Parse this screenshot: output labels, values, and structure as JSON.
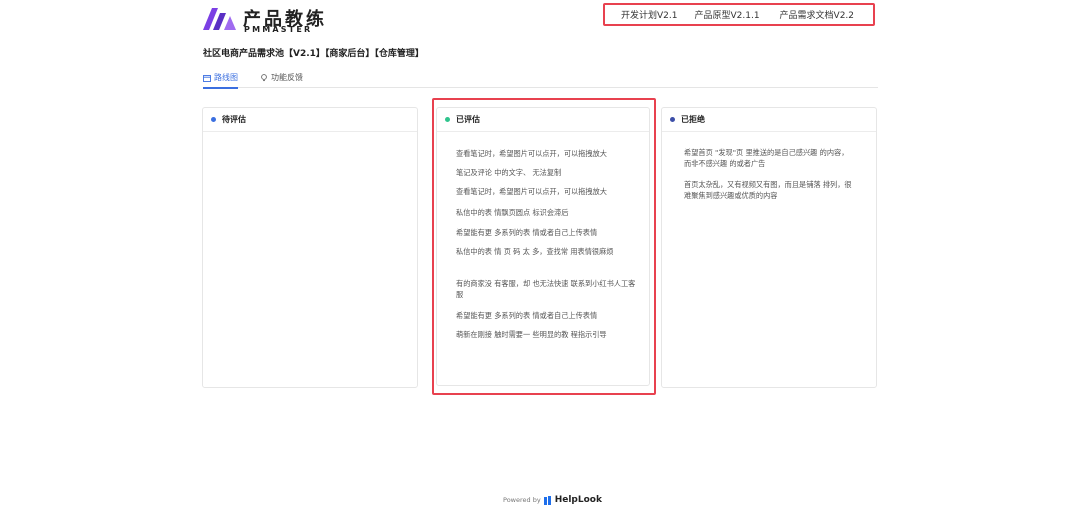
{
  "brand": {
    "name_cn": "产品教练",
    "name_en": "PMMASTER",
    "accent": "#7b3fe4"
  },
  "topnav": {
    "items": [
      "开发计划V2.1",
      "产品原型V2.1.1",
      "产品需求文档V2.2"
    ]
  },
  "page": {
    "title": "社区电商产品需求池【V2.1】【商家后台】【仓库管理】"
  },
  "tabs": [
    {
      "label": "路线图",
      "icon": "calendar-icon",
      "active": true
    },
    {
      "label": "功能反馈",
      "icon": "lightbulb-icon",
      "active": false
    }
  ],
  "columns": [
    {
      "title": "待评估",
      "color": "#3b6fe0",
      "items": []
    },
    {
      "title": "已评估",
      "color": "#2fc48d",
      "items": [
        "查看笔记时，希望图片可以点开，可以拖拽放大",
        "笔记及评论 中的文字、 无法复制",
        "查看笔记时，希望图片可以点开，可以拖拽放大",
        "私信中的表 情飘页圆点 标识会滞后",
        "希望能有更 多系列的表 情或者自己上传表情",
        "私信中的表 情 页 码 太 多，查找常 用表情很麻烦",
        "有的商家没 有客服，却 也无法快速 联系到小红书人工客服",
        "希望能有更 多系列的表 情或者自己上传表情",
        "萌新在刚接 触时需要一 些明显的教 程指示引导"
      ]
    },
    {
      "title": "已拒绝",
      "color": "#3d4fa8",
      "items": [
        "希望首页 \"发现\"页 里推送的是自己感兴趣 的内容，而非不感兴趣 的或者广告",
        "首页太杂乱，又有视频又有图，而且是铺落 排列，很难聚焦到感兴趣或优质的内容"
      ]
    }
  ],
  "footer": {
    "powered": "Powered by",
    "brand": "HelpLook",
    "brand_color": "#1f6feb"
  },
  "colors": {
    "highlight": "#e8414f",
    "tab_active": "#3b6fe0"
  }
}
